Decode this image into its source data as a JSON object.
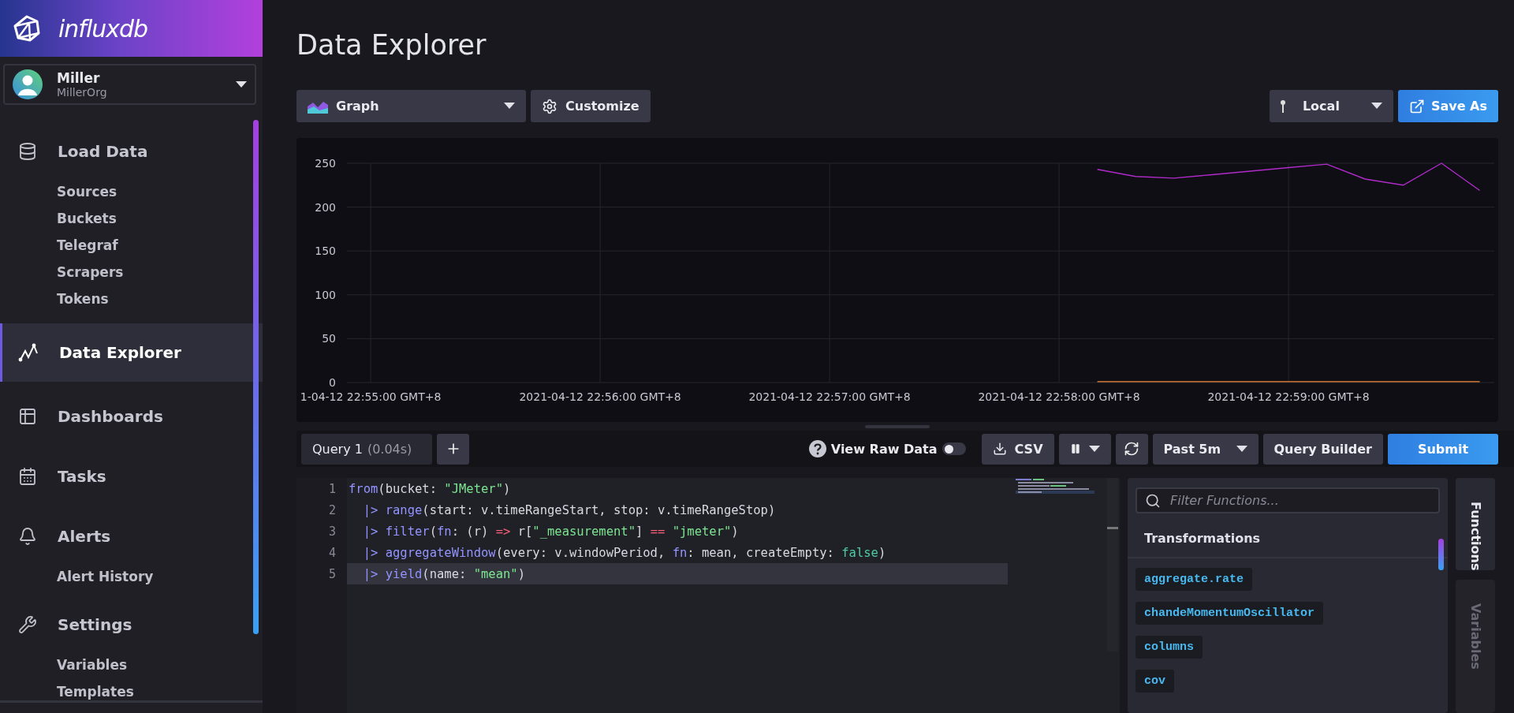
{
  "brand": {
    "logo": "**influx**db"
  },
  "user": {
    "name": "Miller",
    "org": "MillerOrg"
  },
  "nav": [
    {
      "label": "Load Data",
      "selected": false,
      "children": [
        {
          "label": "Sources",
          "selected": false
        },
        {
          "label": "Buckets",
          "selected": false
        },
        {
          "label": "Telegraf",
          "selected": false
        },
        {
          "label": "Scrapers",
          "selected": false
        },
        {
          "label": "Tokens",
          "selected": false
        }
      ]
    },
    {
      "label": "Data Explorer",
      "selected": true
    },
    {
      "label": "Dashboards",
      "selected": false
    },
    {
      "label": "Tasks",
      "selected": false
    },
    {
      "label": "Alerts",
      "selected": false,
      "children": [
        {
          "label": "Alert History",
          "selected": false
        }
      ]
    },
    {
      "label": "Settings",
      "selected": false,
      "children": [
        {
          "label": "Variables",
          "selected": false
        },
        {
          "label": "Templates",
          "selected": false
        }
      ]
    }
  ],
  "page_title": "Data Explorer",
  "toolbar": {
    "view_type": "Graph",
    "customize": "Customize",
    "timezone": "Local",
    "save_as": "Save As"
  },
  "chart_data": {
    "type": "line",
    "grid": true,
    "categories": [
      "1-04-12 22:55:00 GMT+8",
      null,
      null,
      null,
      null,
      null,
      "2021-04-12 22:56:00 GMT+8",
      null,
      null,
      null,
      null,
      null,
      "2021-04-12 22:57:00 GMT+8",
      null,
      null,
      null,
      null,
      null,
      "2021-04-12 22:58:00 GMT+8",
      null,
      null,
      null,
      null,
      null,
      "2021-04-12 22:59:00 GMT+8",
      null,
      null,
      null,
      null,
      null
    ],
    "series": [
      {
        "color": "#b02bc9",
        "values": [
          null,
          null,
          null,
          null,
          null,
          null,
          null,
          null,
          null,
          null,
          null,
          null,
          null,
          null,
          null,
          null,
          null,
          null,
          null,
          243,
          235,
          233,
          237,
          241,
          245,
          249,
          232,
          225,
          250,
          219
        ]
      },
      {
        "color": "#f48d38",
        "values": [
          null,
          null,
          null,
          null,
          null,
          null,
          null,
          null,
          null,
          null,
          null,
          null,
          null,
          null,
          null,
          null,
          null,
          null,
          null,
          1,
          1,
          1,
          1,
          1,
          1,
          1,
          1,
          1,
          1,
          1
        ]
      }
    ],
    "ylim": [
      0,
      250
    ],
    "yticks": [
      0,
      50,
      100,
      150,
      200,
      250
    ]
  },
  "query_bar": {
    "tabs": [
      {
        "label": "Query 1",
        "time": "(0.04s)",
        "selected": true
      }
    ],
    "raw_data": {
      "label": "View Raw Data",
      "on": false
    },
    "csv": "CSV",
    "time_range": "Past 5m",
    "query_builder": "Query Builder",
    "submit": "Submit"
  },
  "editor": {
    "lines": [
      {
        "number": "1",
        "highlighted": false,
        "tokens": [
          {
            "text": "from",
            "kind": "fn"
          },
          {
            "text": "(bucket: ",
            "kind": "plain"
          },
          {
            "text": "\"JMeter\"",
            "kind": "str"
          },
          {
            "text": ")",
            "kind": "plain"
          }
        ]
      },
      {
        "number": "2",
        "highlighted": false,
        "tokens": [
          {
            "text": "  |> ",
            "kind": "pipe"
          },
          {
            "text": "range",
            "kind": "fn"
          },
          {
            "text": "(start: v.timeRangeStart, stop: v.timeRangeStop)",
            "kind": "plain"
          }
        ]
      },
      {
        "number": "3",
        "highlighted": false,
        "tokens": [
          {
            "text": "  |> ",
            "kind": "pipe"
          },
          {
            "text": "filter",
            "kind": "fn"
          },
          {
            "text": "(",
            "kind": "plain"
          },
          {
            "text": "fn",
            "kind": "fn"
          },
          {
            "text": ": (r) ",
            "kind": "plain"
          },
          {
            "text": "=>",
            "kind": "op"
          },
          {
            "text": " r[",
            "kind": "plain"
          },
          {
            "text": "\"_measurement\"",
            "kind": "str"
          },
          {
            "text": "] ",
            "kind": "plain"
          },
          {
            "text": "== ",
            "kind": "op"
          },
          {
            "text": "\"jmeter\"",
            "kind": "str"
          },
          {
            "text": ")",
            "kind": "plain"
          }
        ]
      },
      {
        "number": "4",
        "highlighted": false,
        "tokens": [
          {
            "text": "  |> ",
            "kind": "pipe"
          },
          {
            "text": "aggregateWindow",
            "kind": "fn"
          },
          {
            "text": "(every: v.windowPeriod, ",
            "kind": "plain"
          },
          {
            "text": "fn",
            "kind": "fn"
          },
          {
            "text": ": mean, createEmpty: ",
            "kind": "plain"
          },
          {
            "text": "false",
            "kind": "bool"
          },
          {
            "text": ")",
            "kind": "plain"
          }
        ]
      },
      {
        "number": "5",
        "highlighted": true,
        "tokens": [
          {
            "text": "  |> ",
            "kind": "pipe"
          },
          {
            "text": "yield",
            "kind": "fn"
          },
          {
            "text": "(name: ",
            "kind": "plain"
          },
          {
            "text": "\"mean\"",
            "kind": "str"
          },
          {
            "text": ")",
            "kind": "plain"
          }
        ]
      }
    ]
  },
  "functions": {
    "placeholder": "Filter Functions...",
    "section": "Transformations",
    "items": [
      "aggregate.rate",
      "chandeMomentumOscillator",
      "columns",
      "cov"
    ]
  },
  "side_tabs": [
    {
      "label": "Functions",
      "selected": true
    },
    {
      "label": "Variables",
      "selected": false
    }
  ]
}
